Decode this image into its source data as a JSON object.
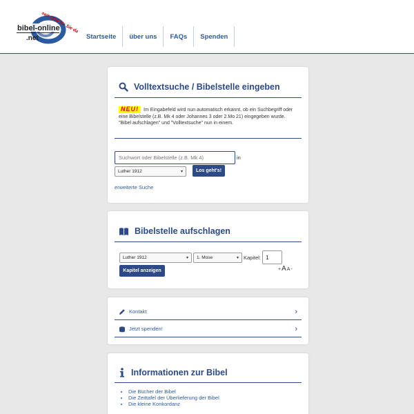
{
  "header": {
    "logo": {
      "wordmark": "bibel-online",
      "domain": ".net",
      "tagline": "seit 1996 für Sie da"
    },
    "nav": [
      "Startseite",
      "über uns",
      "FAQs",
      "Spenden"
    ]
  },
  "search_card": {
    "title": "Volltextsuche / Bibelstelle eingeben",
    "icon": "search-icon",
    "new_badge": "NEU!",
    "notice": "Im Eingabefeld wird nun automatisch erkannt, ob ein Suchbegriff oder eine Bibelstelle (z.B. Mk 4 oder Johannes 3 oder 2.Mo 21) eingegeben wurde. \"Bibel aufschlagen\" und \"Volltextsuche\" nun in einem.",
    "input_placeholder": "Suchwort oder Bibelstelle (z.B. Mk 4)",
    "in_label": "in",
    "translation": "Luther 1912",
    "submit": "Los geht's!",
    "advanced_link": "erweiterte Suche"
  },
  "open_card": {
    "title": "Bibelstelle aufschlagen",
    "icon": "open-book-icon",
    "translation": "Luther 1912",
    "book": "1. Mose",
    "chapter_label": "Kapitel:",
    "chapter_value": "1",
    "show_button": "Kapitel anzeigen",
    "font_controls": {
      "plus": "+",
      "big": "A",
      "small": "A",
      "minus": "-"
    }
  },
  "links_card": {
    "items": [
      {
        "label": "Kontakt",
        "icon": "pencil-icon"
      },
      {
        "label": "Jetzt spenden!",
        "icon": "coins-icon"
      }
    ]
  },
  "info_card": {
    "title": "Informationen zur Bibel",
    "icon": "info-icon",
    "items": [
      "Die Bücher der Bibel",
      "Die Zeittafel der Überlieferung der Bibel",
      "Die kleine Konkordanz"
    ]
  },
  "colors": {
    "brand": "#2c4a86",
    "link": "#2c5aa0",
    "page_bg": "#e8e8e8",
    "badge_bg": "#ffff00",
    "badge_text": "#e00000"
  }
}
